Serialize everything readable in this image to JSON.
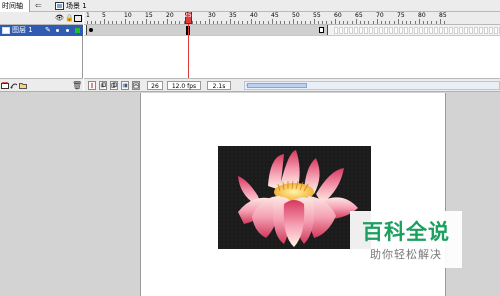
{
  "topbar": {
    "timeline_tab": "时间轴",
    "scene_label": "场景 1"
  },
  "layers": [
    {
      "name": "图层 1",
      "selected": true
    }
  ],
  "ruler": {
    "labels": [
      "1",
      "5",
      "10",
      "15",
      "20",
      "25",
      "30",
      "35",
      "40",
      "45",
      "50",
      "55",
      "60",
      "65",
      "70",
      "75",
      "80",
      "85"
    ]
  },
  "status": {
    "current_frame": "26",
    "frame_rate": "12.0 fps",
    "elapsed_time": "2.1s"
  },
  "watermark": {
    "title": "百科全说",
    "subtitle": "助你轻松解决"
  },
  "colors": {
    "layer_highlight": "#2f5bb3",
    "playhead": "#e03c3c",
    "watermark_green": "#1aa05f",
    "stage_background": "#d3d3d3"
  }
}
